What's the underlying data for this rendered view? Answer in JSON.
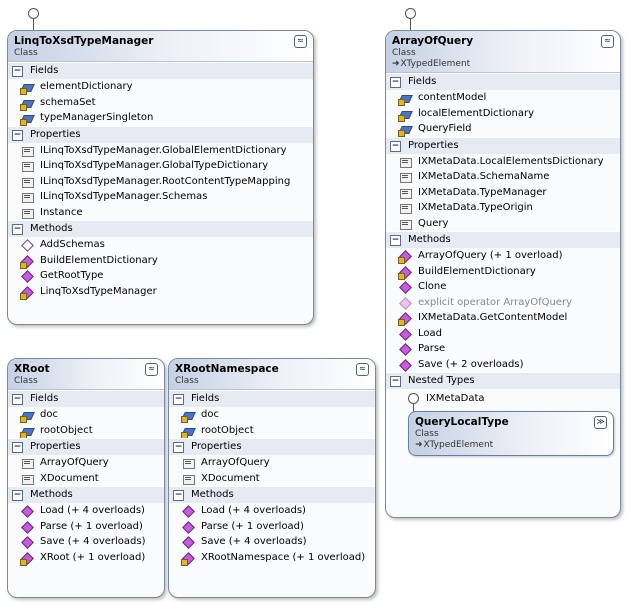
{
  "classes": {
    "linq": {
      "name": "LinqToXsdTypeManager",
      "stereotype": "Class",
      "sections": {
        "fields": {
          "label": "Fields",
          "items": [
            "elementDictionary",
            "schemaSet",
            "typeManagerSingleton"
          ]
        },
        "properties": {
          "label": "Properties",
          "items": [
            "ILinqToXsdTypeManager.GlobalElementDictionary",
            "ILinqToXsdTypeManager.GlobalTypeDictionary",
            "ILinqToXsdTypeManager.RootContentTypeMapping",
            "ILinqToXsdTypeManager.Schemas",
            "Instance"
          ]
        },
        "methods": {
          "label": "Methods",
          "items": [
            "AddSchemas",
            "BuildElementDictionary",
            "GetRootType",
            "LinqToXsdTypeManager"
          ]
        }
      }
    },
    "xroot": {
      "name": "XRoot",
      "stereotype": "Class",
      "sections": {
        "fields": {
          "label": "Fields",
          "items": [
            "doc",
            "rootObject"
          ]
        },
        "properties": {
          "label": "Properties",
          "items": [
            "ArrayOfQuery",
            "XDocument"
          ]
        },
        "methods": {
          "label": "Methods",
          "items": [
            "Load (+ 4 overloads)",
            "Parse (+ 1 overload)",
            "Save (+ 4 overloads)",
            "XRoot (+ 1 overload)"
          ]
        }
      }
    },
    "xrootns": {
      "name": "XRootNamespace",
      "stereotype": "Class",
      "sections": {
        "fields": {
          "label": "Fields",
          "items": [
            "doc",
            "rootObject"
          ]
        },
        "properties": {
          "label": "Properties",
          "items": [
            "ArrayOfQuery",
            "XDocument"
          ]
        },
        "methods": {
          "label": "Methods",
          "items": [
            "Load (+ 4 overloads)",
            "Parse (+ 1 overload)",
            "Save (+ 4 overloads)",
            "XRootNamespace (+ 1 overload)"
          ]
        }
      }
    },
    "aoq": {
      "name": "ArrayOfQuery",
      "stereotype": "Class",
      "base": "XTypedElement",
      "sections": {
        "fields": {
          "label": "Fields",
          "items": [
            "contentModel",
            "localElementDictionary",
            "QueryField"
          ]
        },
        "properties": {
          "label": "Properties",
          "items": [
            "IXMetaData.LocalElementsDictionary",
            "IXMetaData.SchemaName",
            "IXMetaData.TypeManager",
            "IXMetaData.TypeOrigin",
            "Query"
          ]
        },
        "methods": {
          "label": "Methods",
          "items": [
            "ArrayOfQuery (+ 1 overload)",
            "BuildElementDictionary",
            "Clone",
            "explicit operator ArrayOfQuery",
            "IXMetaData.GetContentModel",
            "Load",
            "Parse",
            "Save (+ 2 overloads)"
          ]
        },
        "nested": {
          "label": "Nested Types"
        }
      },
      "nested_interface": "IXMetaData",
      "nested_class": {
        "name": "QueryLocalType",
        "stereotype": "Class",
        "base": "XTypedElement"
      }
    }
  },
  "glyphs": {
    "collapse": "≈",
    "expand": "≫",
    "minus": "−",
    "base_arrow": "➜"
  },
  "colors": {
    "box_border": "#7a8aa0",
    "header_gradient": "#c6d0e4",
    "section_bg": "#e6eaf2",
    "method_icon": "#c25fd6",
    "field_icon": "#4e74c0"
  }
}
